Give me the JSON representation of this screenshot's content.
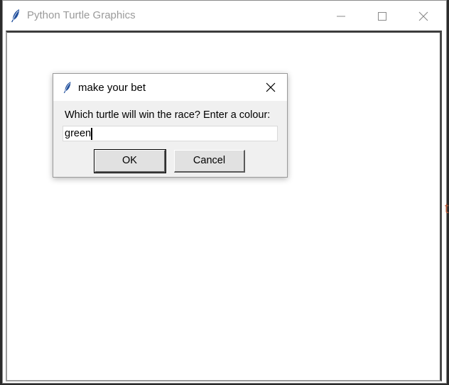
{
  "main_window": {
    "title": "Python Turtle Graphics",
    "icon": "feather-icon",
    "controls": [
      "minimize-icon",
      "maximize-icon",
      "close-icon"
    ]
  },
  "dialog": {
    "title": "make your bet",
    "icon": "feather-icon",
    "prompt": "Which turtle will win the race? Enter a colour:",
    "input_value": "green",
    "ok_label": "OK",
    "cancel_label": "Cancel"
  },
  "background_fragment": "t",
  "colors": {
    "titlebar_text": "#9a9a9a",
    "dialog_bg": "#f0f0f0",
    "button_bg": "#e1e1e1"
  }
}
